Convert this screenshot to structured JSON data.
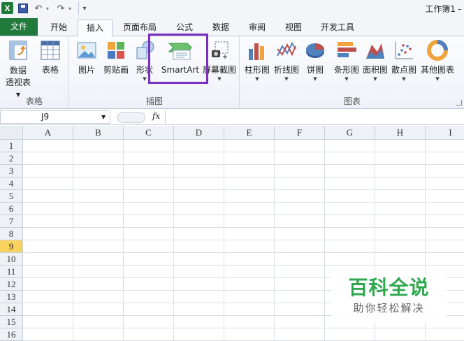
{
  "window": {
    "title": "工作簿1 -"
  },
  "quick_access": {
    "undo": "↶",
    "redo": "↷",
    "customize": "▾"
  },
  "tabs": [
    "文件",
    "开始",
    "插入",
    "页面布局",
    "公式",
    "数据",
    "审阅",
    "视图",
    "开发工具"
  ],
  "active_tab": "插入",
  "ribbon": {
    "groups": [
      {
        "label": "表格",
        "buttons": [
          {
            "label": "数据\n透视表 ▾",
            "icon": "pivot-table-icon"
          },
          {
            "label": "表格",
            "icon": "table-icon"
          }
        ]
      },
      {
        "label": "插图",
        "buttons": [
          {
            "label": "图片",
            "icon": "picture-icon"
          },
          {
            "label": "剪贴画",
            "icon": "clipart-icon"
          },
          {
            "label": "形状",
            "icon": "shapes-icon"
          },
          {
            "label": "SmartArt",
            "icon": "smartart-icon"
          },
          {
            "label": "屏幕截图",
            "icon": "screenshot-icon"
          }
        ]
      },
      {
        "label": "图表",
        "buttons": [
          {
            "label": "柱形图",
            "icon": "column-chart-icon"
          },
          {
            "label": "折线图",
            "icon": "line-chart-icon"
          },
          {
            "label": "饼图",
            "icon": "pie-chart-icon"
          },
          {
            "label": "条形图",
            "icon": "bar-chart-icon"
          },
          {
            "label": "面积图",
            "icon": "area-chart-icon"
          },
          {
            "label": "散点图",
            "icon": "scatter-chart-icon"
          },
          {
            "label": "其他图表",
            "icon": "other-charts-icon"
          }
        ]
      }
    ],
    "highlighted_button": "SmartArt"
  },
  "formula_bar": {
    "name_box": "J9",
    "fx": "fx",
    "formula": ""
  },
  "grid": {
    "columns": [
      "A",
      "B",
      "C",
      "D",
      "E",
      "F",
      "G",
      "H",
      "I"
    ],
    "rows": [
      "1",
      "2",
      "3",
      "4",
      "5",
      "6",
      "7",
      "8",
      "9",
      "10",
      "11",
      "12",
      "13",
      "14",
      "15",
      "16"
    ],
    "selected_row": "9"
  },
  "watermark": {
    "main": "百科全说",
    "sub": "助你轻松解决"
  },
  "colors": {
    "file_tab": "#1f7a3c",
    "highlight_border": "#7b2fbe",
    "selected_row_header": "#f9d25e",
    "watermark_green": "#2fa84f"
  }
}
